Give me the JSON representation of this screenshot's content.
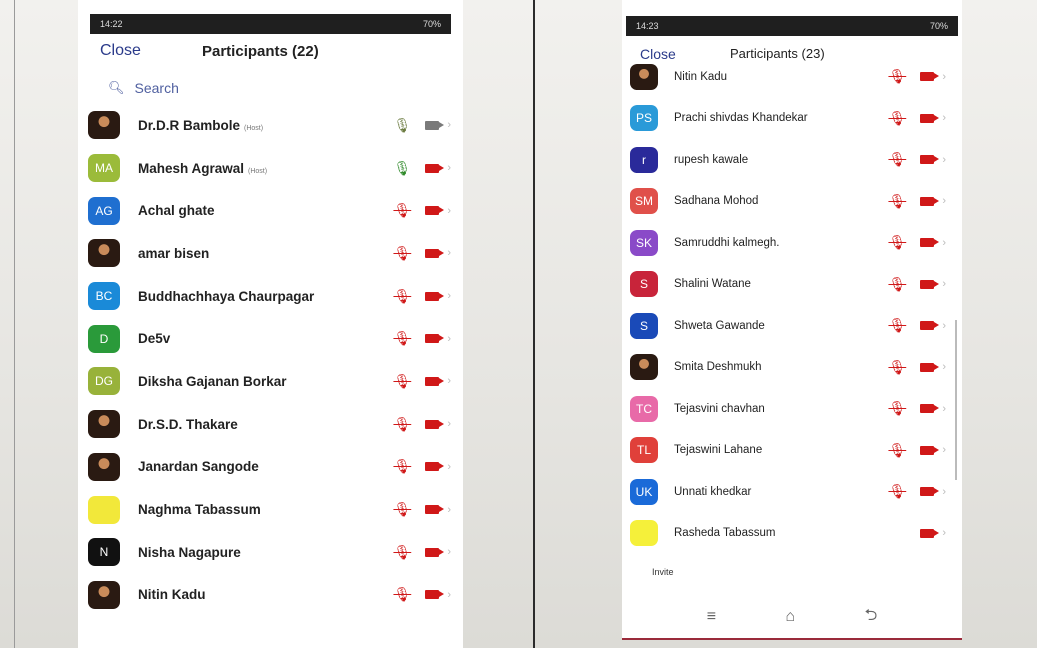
{
  "colors": {
    "accent_text": "#2a3a8a",
    "muted_icon": "#d01818"
  },
  "left": {
    "status": {
      "time": "14:22",
      "battery": "70%"
    },
    "close_label": "Close",
    "title": "Participants (22)",
    "search_placeholder": "Search",
    "participants": [
      {
        "name": "Dr.D.R Bambole",
        "tag": "(Host)",
        "initials": "",
        "avatar_color": "",
        "photo": true,
        "mic": "on",
        "cam": "grey"
      },
      {
        "name": "Mahesh Agrawal",
        "tag": "(Host)",
        "initials": "MA",
        "avatar_color": "#9bbb3a",
        "photo": false,
        "mic": "green",
        "cam": "off"
      },
      {
        "name": "Achal ghate",
        "tag": "",
        "initials": "AG",
        "avatar_color": "#1f6fd0",
        "photo": false,
        "mic": "off",
        "cam": "off"
      },
      {
        "name": "amar bisen",
        "tag": "",
        "initials": "",
        "avatar_color": "",
        "photo": true,
        "mic": "off",
        "cam": "off"
      },
      {
        "name": "Buddhachhaya Chaurpagar",
        "tag": "",
        "initials": "BC",
        "avatar_color": "#1a8ad8",
        "photo": false,
        "mic": "off",
        "cam": "off"
      },
      {
        "name": "De5v",
        "tag": "",
        "initials": "D",
        "avatar_color": "#2a9a3a",
        "photo": false,
        "mic": "off",
        "cam": "off"
      },
      {
        "name": "Diksha Gajanan Borkar",
        "tag": "",
        "initials": "DG",
        "avatar_color": "#98b23a",
        "photo": false,
        "mic": "off",
        "cam": "off"
      },
      {
        "name": "Dr.S.D. Thakare",
        "tag": "",
        "initials": "",
        "avatar_color": "",
        "photo": true,
        "mic": "off",
        "cam": "off"
      },
      {
        "name": "Janardan Sangode",
        "tag": "",
        "initials": "",
        "avatar_color": "",
        "photo": true,
        "mic": "off",
        "cam": "off"
      },
      {
        "name": "Naghma Tabassum",
        "tag": "",
        "initials": "",
        "avatar_color": "#f2e83a",
        "photo": false,
        "mic": "off",
        "cam": "off"
      },
      {
        "name": "Nisha Nagapure",
        "tag": "",
        "initials": "N",
        "avatar_color": "#111111",
        "photo": false,
        "mic": "off",
        "cam": "off"
      },
      {
        "name": "Nitin Kadu",
        "tag": "",
        "initials": "",
        "avatar_color": "",
        "photo": true,
        "mic": "off",
        "cam": "off"
      }
    ]
  },
  "right": {
    "status": {
      "time": "14:23",
      "battery": "70%"
    },
    "close_label": "Close",
    "title": "Participants (23)",
    "participants": [
      {
        "name": "Nitin Kadu",
        "initials": "",
        "avatar_color": "",
        "photo": true,
        "mic": "off",
        "cam": "off"
      },
      {
        "name": "Prachi shivdas Khandekar",
        "initials": "PS",
        "avatar_color": "#2a9ad8",
        "photo": false,
        "mic": "off",
        "cam": "off"
      },
      {
        "name": "rupesh kawale",
        "initials": "r",
        "avatar_color": "#2a2a9a",
        "photo": false,
        "mic": "off",
        "cam": "off"
      },
      {
        "name": "Sadhana Mohod",
        "initials": "SM",
        "avatar_color": "#e0504a",
        "photo": false,
        "mic": "off",
        "cam": "off"
      },
      {
        "name": "Samruddhi kalmegh.",
        "initials": "SK",
        "avatar_color": "#8a4ac8",
        "photo": false,
        "mic": "off",
        "cam": "off"
      },
      {
        "name": "Shalini Watane",
        "initials": "S",
        "avatar_color": "#c8243a",
        "photo": false,
        "mic": "off",
        "cam": "off"
      },
      {
        "name": "Shweta Gawande",
        "initials": "S",
        "avatar_color": "#1a4ab8",
        "photo": false,
        "mic": "off",
        "cam": "off"
      },
      {
        "name": "Smita Deshmukh",
        "initials": "",
        "avatar_color": "",
        "photo": true,
        "mic": "off",
        "cam": "off"
      },
      {
        "name": "Tejasvini chavhan",
        "initials": "TC",
        "avatar_color": "#e86aa8",
        "photo": false,
        "mic": "off",
        "cam": "off"
      },
      {
        "name": "Tejaswini Lahane",
        "initials": "TL",
        "avatar_color": "#e0403a",
        "photo": false,
        "mic": "off",
        "cam": "off"
      },
      {
        "name": "Unnati khedkar",
        "initials": "UK",
        "avatar_color": "#1a6ad8",
        "photo": false,
        "mic": "off",
        "cam": "off"
      },
      {
        "name": "Rasheda Tabassum",
        "initials": "",
        "avatar_color": "#f5f03a",
        "photo": false,
        "mic": "none",
        "cam": "off"
      }
    ],
    "invite_label": "Invite",
    "nav": {
      "menu": "≡",
      "home": "⌂",
      "back": "⮌"
    }
  }
}
